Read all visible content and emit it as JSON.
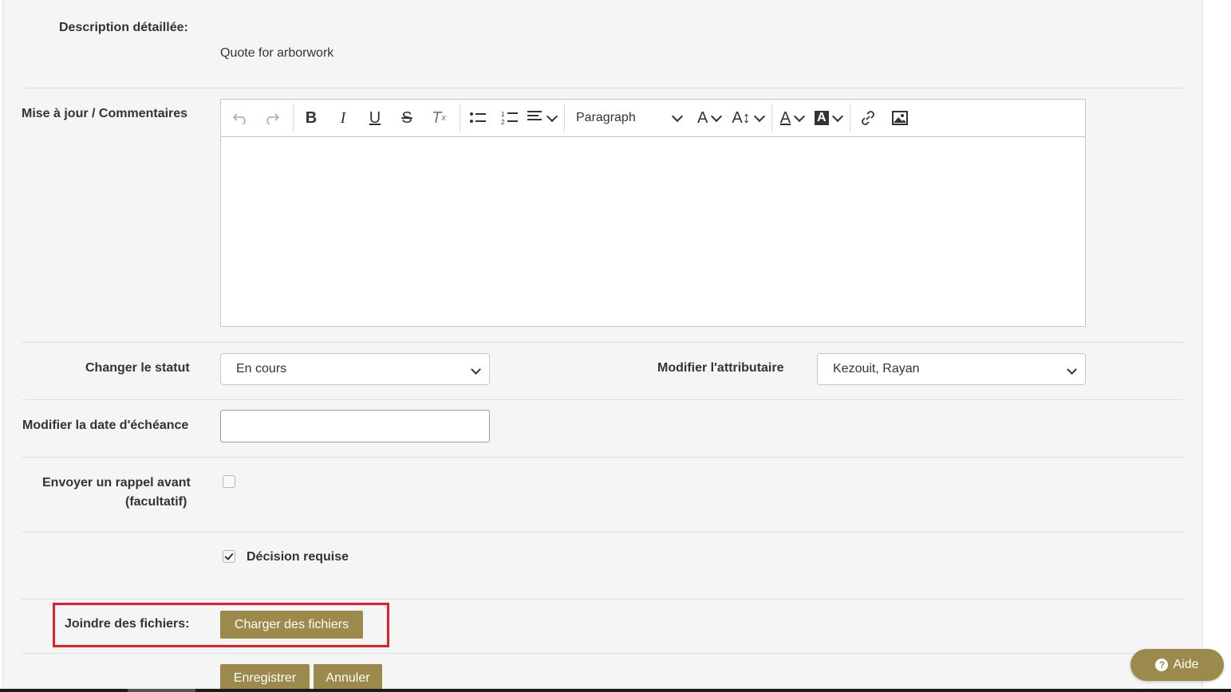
{
  "description": {
    "label": "Description détaillée:",
    "value": "Quote for arborwork"
  },
  "comments": {
    "label": "Mise à jour / Commentaires",
    "toolbar": {
      "paragraph_label": "Paragraph",
      "icons": [
        "undo-icon",
        "redo-icon",
        "bold-icon",
        "italic-icon",
        "underline-icon",
        "strikethrough-icon",
        "clear-format-icon",
        "bullet-list-icon",
        "numbered-list-icon",
        "align-icon",
        "font-size-icon",
        "line-height-icon",
        "font-color-icon",
        "highlight-color-icon",
        "link-icon",
        "image-icon"
      ]
    },
    "content": ""
  },
  "status": {
    "label": "Changer le statut",
    "selected": "En cours"
  },
  "assignee": {
    "label": "Modifier l'attributaire",
    "selected": "Kezouit, Rayan"
  },
  "due_date": {
    "label": "Modifier la date d'échéance",
    "value": ""
  },
  "reminder": {
    "label_line1": "Envoyer un rappel avant",
    "label_line2": "(facultatif)",
    "checked": false
  },
  "decision": {
    "label": "Décision requise",
    "checked": true
  },
  "attachments": {
    "label": "Joindre des fichiers:",
    "upload_label": "Charger des fichiers"
  },
  "actions": {
    "save_label": "Enregistrer",
    "cancel_label": "Annuler"
  },
  "help": {
    "label": "Aide",
    "icon_glyph": "?"
  },
  "colors": {
    "accent": "#9b8a4c",
    "highlight_border": "#e0202a"
  }
}
